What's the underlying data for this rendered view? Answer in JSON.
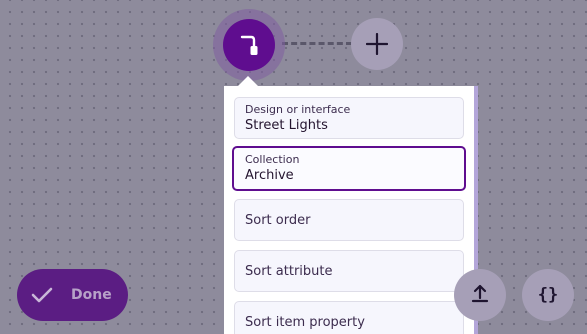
{
  "canvas": {
    "main_node_icon": "lamp-post-icon",
    "add_node_icon": "plus-icon"
  },
  "popup": {
    "fields": [
      {
        "label": "Design or interface",
        "value": "Street Lights"
      },
      {
        "label": "Collection",
        "value": "Archive"
      },
      {
        "placeholder": "Sort order"
      },
      {
        "placeholder": "Sort attribute"
      },
      {
        "placeholder": "Sort item property"
      }
    ]
  },
  "controls": {
    "done_label": "Done",
    "done_icon": "checkmark-icon",
    "upload_icon": "upload-icon",
    "code_label": "{}",
    "code_icon": "curly-braces-icon"
  },
  "colors": {
    "accent": "#5f0d8f",
    "background": "#8e8b9c",
    "secondary_button": "#a69fb7"
  }
}
